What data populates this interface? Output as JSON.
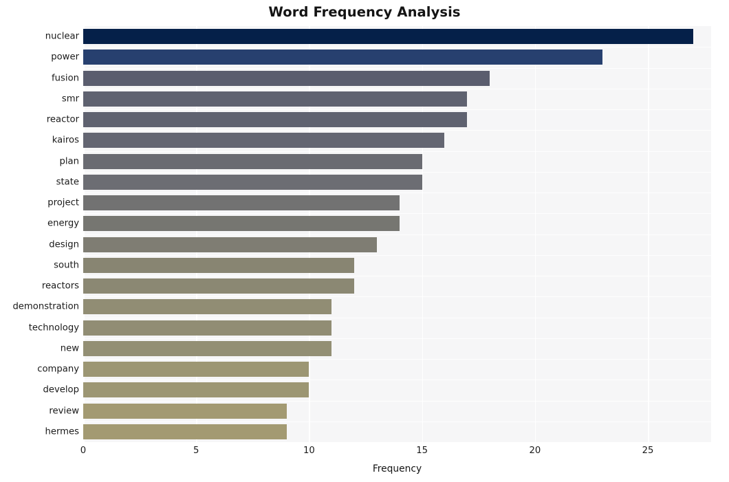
{
  "chart_data": {
    "type": "bar",
    "orientation": "horizontal",
    "title": "Word Frequency Analysis",
    "xlabel": "Frequency",
    "ylabel": "",
    "xlim": [
      0,
      27.8
    ],
    "x_ticks": [
      0,
      5,
      10,
      15,
      20,
      25
    ],
    "x_tick_labels": [
      "0",
      "5",
      "10",
      "15",
      "20",
      "25"
    ],
    "grid": "vertical-white-on-light",
    "legend": "none",
    "categories": [
      "nuclear",
      "power",
      "fusion",
      "smr",
      "reactor",
      "kairos",
      "plan",
      "state",
      "project",
      "energy",
      "design",
      "south",
      "reactors",
      "demonstration",
      "technology",
      "new",
      "company",
      "develop",
      "review",
      "hermes"
    ],
    "values": [
      27,
      23,
      18,
      17,
      17,
      16,
      15,
      15,
      14,
      14,
      13,
      12,
      12,
      11,
      11,
      11,
      10,
      10,
      9,
      9
    ],
    "bar_colors": [
      "#052049",
      "#27406f",
      "#5a5d6e",
      "#5f6270",
      "#5f6270",
      "#646672",
      "#6a6b72",
      "#6c6d73",
      "#727272",
      "#767671",
      "#7f7d73",
      "#888572",
      "#8b8873",
      "#918d74",
      "#918d74",
      "#938f74",
      "#9c9673",
      "#9c9673",
      "#a39a72",
      "#a39a72"
    ],
    "plot_background": "#f6f6f7",
    "figure_background": "#ffffff",
    "title_color": "#141414",
    "tick_label_color": "#1a1a1a"
  }
}
